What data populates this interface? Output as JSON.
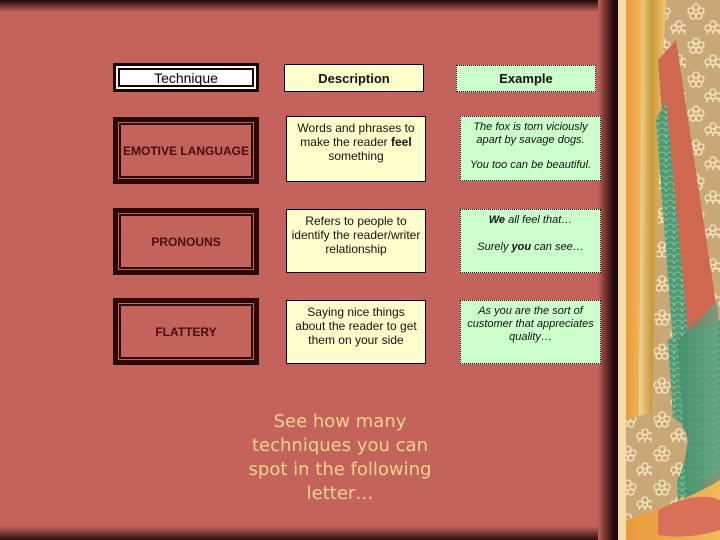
{
  "headers": {
    "technique": "Technique",
    "description": "Description",
    "example": "Example"
  },
  "rows": [
    {
      "technique": "EMOTIVE LANGUAGE",
      "description_pre": "Words and phrases to make the reader ",
      "description_bold": "feel",
      "description_post": " something",
      "examples": [
        {
          "pre": "",
          "bold": "",
          "post": "The fox is torn viciously apart by savage dogs."
        },
        {
          "pre": "",
          "bold": "",
          "post": "You too can be beautiful."
        }
      ]
    },
    {
      "technique": "PRONOUNS",
      "description_pre": "Refers to people to identify the reader/writer relationship",
      "description_bold": "",
      "description_post": "",
      "examples": [
        {
          "pre": "",
          "bold": "We",
          "post": " all feel that…"
        },
        {
          "pre": "Surely ",
          "bold": "you",
          "post": " can see…"
        }
      ]
    },
    {
      "technique": "FLATTERY",
      "description_pre": "Saying nice things about the reader to get them on your side",
      "description_bold": "",
      "description_post": "",
      "examples": [
        {
          "pre": "",
          "bold": "",
          "post": "As you are the sort of customer that appreciates quality…"
        }
      ]
    }
  ],
  "footer": "See how many techniques you can spot in the following letter…",
  "colors": {
    "background": "#c4625c",
    "description_fill": "#ffffcc",
    "example_fill": "#ccffcc",
    "footer_text": "#f8d48a"
  }
}
